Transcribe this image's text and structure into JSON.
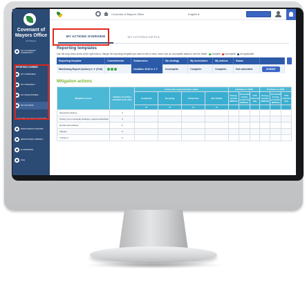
{
  "sidebar": {
    "brand_line1": "Covenant of",
    "brand_line2": "Mayors Office",
    "brand_sub": "EU Mayors",
    "items": [
      {
        "label": "My Covenant Community"
      },
      {
        "label": "Reporting Corner",
        "heading": true
      },
      {
        "label": "My Overview"
      },
      {
        "label": "My Strategy"
      },
      {
        "label": "My Inventories"
      },
      {
        "label": "My Actions",
        "active": true
      },
      {
        "label": "Capacity Sharing Corner",
        "heading": true
      },
      {
        "label": "Discussion Forums"
      },
      {
        "label": "Resources Library"
      },
      {
        "label": "E-Learning"
      },
      {
        "label": "FAQ"
      }
    ]
  },
  "topbar": {
    "office": "Covenant of Mayors Office",
    "language": "English ▾"
  },
  "tabs": [
    {
      "label": "My Actions Overview",
      "active": true
    },
    {
      "label": "My Actions Detail",
      "active": false
    }
  ],
  "reporting": {
    "title": "Reporting templates",
    "instruction": "Use the drop-down arrow at the right side to change the reporting template you want to edit or view, hover over an incomplete status to see the detail:",
    "legend": [
      {
        "label": "complete",
        "color": "#3aa84a"
      },
      {
        "label": "incomplete",
        "color": "#e1251b"
      },
      {
        "label": "not applicable",
        "color": "#2b4a74"
      }
    ],
    "columns": [
      "Reporting template",
      "Commitments",
      "Submission",
      "My strategy",
      "My inventories",
      "My actions",
      "Status",
      ""
    ],
    "row": {
      "template": "Monitoring Report (Action) 2 ▼ (Full)",
      "submission": "Deadline 2016 in 1 Y",
      "strategy": "Incomplete",
      "inventories": "Complete",
      "actions": "Complete",
      "status": "Not submitted",
      "button": "SUBMIT"
    }
  },
  "mitigation": {
    "title": "Mitigation actions",
    "header_left": "Mitigation sector",
    "header_count": "Number of actions included in the plan",
    "group1": "Action plan implementation status",
    "group2": "Estimates in 2020",
    "group3": "Estimates in 2030",
    "status_cols": [
      "Completed",
      "On-going",
      "Postponed",
      "Not started"
    ],
    "est_cols": [
      "Energy savings (MWh/a)",
      "Renewable energy production (MWh/a)",
      "CO2 reduction (t/a)"
    ],
    "units": [
      "%",
      "%",
      "%",
      "%"
    ],
    "rows": [
      {
        "label": "Municipal buildings",
        "count": "0"
      },
      {
        "label": "Tertiary (non municipal) buildings, equipment/facilities",
        "count": "0"
      },
      {
        "label": "Residential buildings",
        "count": "0"
      },
      {
        "label": "Industry",
        "count": "0"
      },
      {
        "label": "Transport",
        "count": "0"
      }
    ]
  }
}
